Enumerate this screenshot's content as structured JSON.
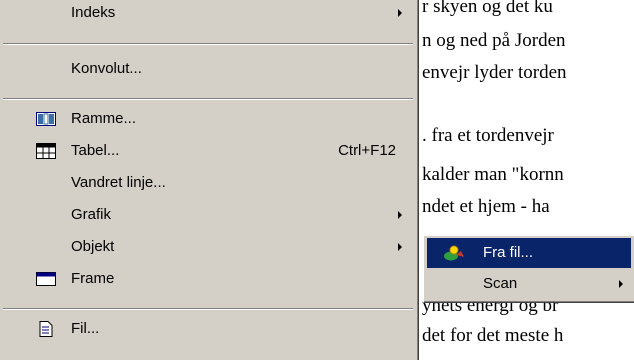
{
  "document": {
    "lines": [
      "r skyen og det ku",
      "n og ned på Jorden",
      "envejr lyder torden",
      ". fra et tordenvejr",
      "kalder man \"kornn",
      "ndet et hjem - ha",
      "ynets energi og br",
      "det for det meste h"
    ]
  },
  "menu": {
    "items": [
      {
        "label": "Indeks",
        "has_submenu": true
      },
      {
        "label": "Konvolut..."
      },
      {
        "label": "Ramme...",
        "icon": "frames-icon"
      },
      {
        "label": "Tabel...",
        "icon": "table-icon",
        "shortcut": "Ctrl+F12"
      },
      {
        "label": "Vandret linje..."
      },
      {
        "label": "Grafik",
        "has_submenu": true
      },
      {
        "label": "Objekt",
        "has_submenu": true
      },
      {
        "label": "Frame",
        "icon": "frame-window-icon"
      },
      {
        "label": "Fil...",
        "icon": "file-icon"
      }
    ]
  },
  "submenu": {
    "items": [
      {
        "label": "Fra fil...",
        "icon": "picture-from-file-icon",
        "selected": true
      },
      {
        "label": "Scan",
        "has_submenu": true
      }
    ]
  },
  "colors": {
    "menu_bg": "#d4d0c8",
    "highlight": "#0a246a",
    "highlight_text": "#ffffff"
  }
}
